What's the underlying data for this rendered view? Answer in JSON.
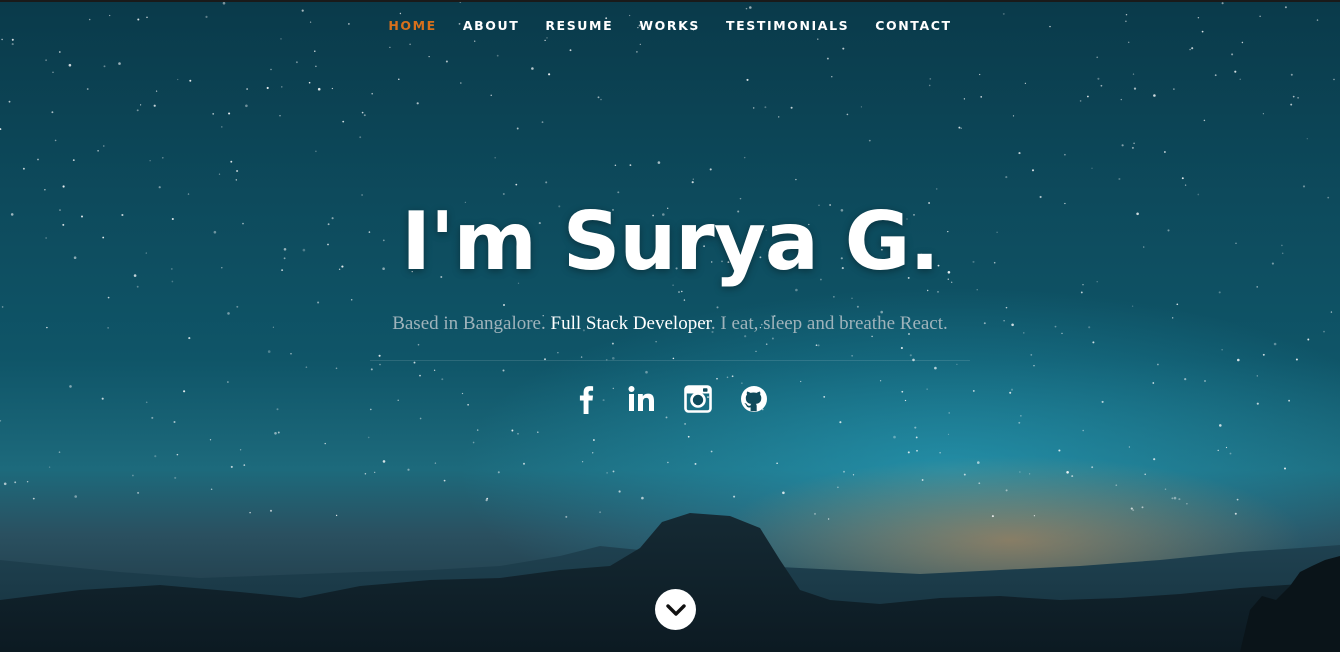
{
  "nav": {
    "items": [
      {
        "label": "HOME",
        "active": true
      },
      {
        "label": "ABOUT",
        "active": false
      },
      {
        "label": "RESUME",
        "active": false
      },
      {
        "label": "WORKS",
        "active": false
      },
      {
        "label": "TESTIMONIALS",
        "active": false
      },
      {
        "label": "CONTACT",
        "active": false
      }
    ],
    "active_color": "#d7701c"
  },
  "hero": {
    "title": "I'm Surya G.",
    "tagline_before": "Based in Bangalore. ",
    "tagline_highlight": "Full Stack Developer",
    "tagline_after": ". I eat, sleep and breathe React."
  },
  "social": [
    {
      "icon": "facebook-icon"
    },
    {
      "icon": "linkedin-icon"
    },
    {
      "icon": "instagram-icon"
    },
    {
      "icon": "github-icon"
    }
  ],
  "scroll_down": {
    "icon": "chevron-down-icon"
  }
}
